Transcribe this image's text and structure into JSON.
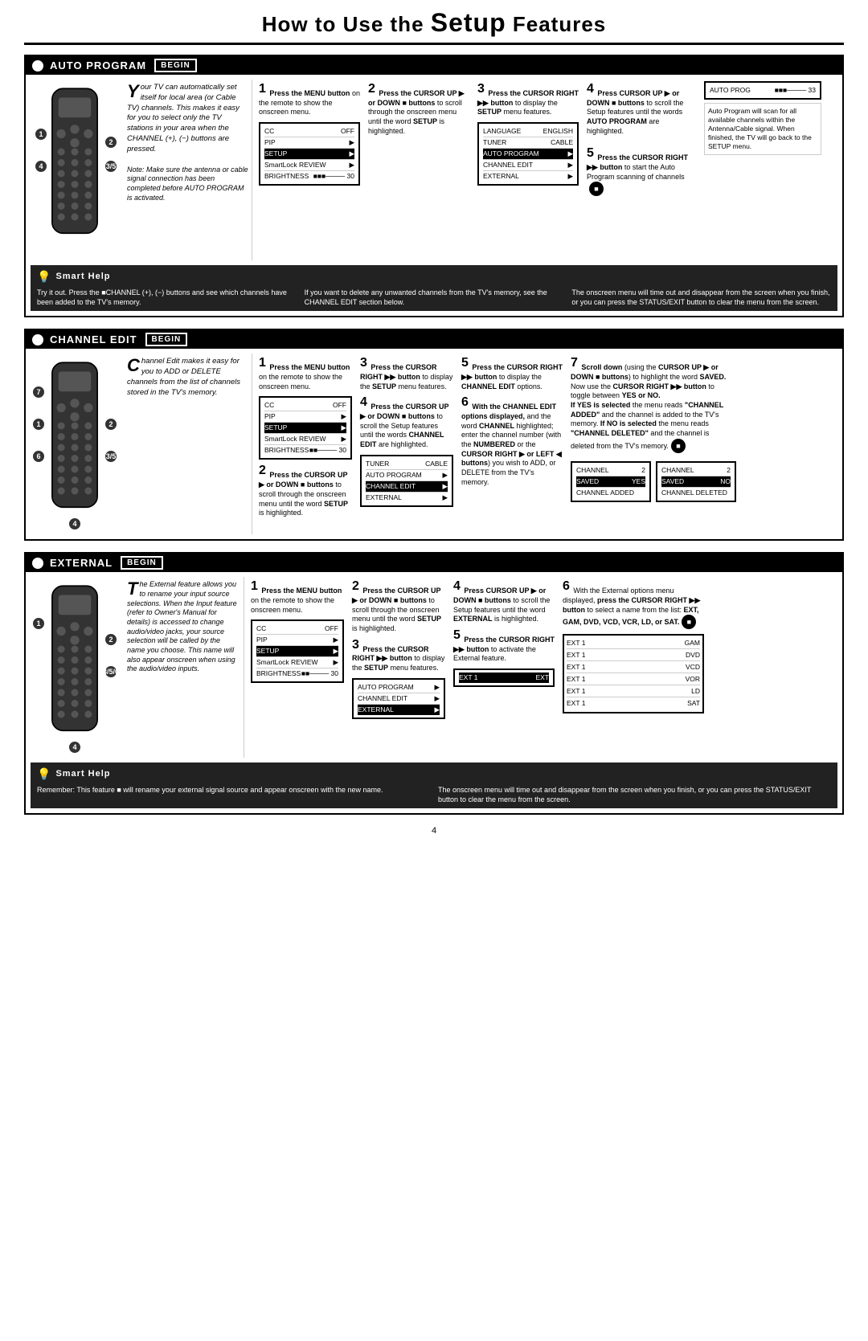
{
  "page": {
    "title_pre": "How to Use the ",
    "title_setup": "Setup",
    "title_post": " Features",
    "page_number": "4"
  },
  "auto_program": {
    "section_title": "Auto Program",
    "begin_label": "BEGIN",
    "intro": {
      "drop_cap": "Y",
      "text": "our TV can automatically set itself for local area (or Cable TV) channels. This makes it easy for you to select only the TV stations in your area when the CHANNEL (+), (−) buttons are pressed.\n\nNote: Make sure the antenna or cable signal connection has been completed before AUTO PROGRAM is activated."
    },
    "steps": [
      {
        "num": "1",
        "text": "Press the MENU button on the remote to show the onscreen menu."
      },
      {
        "num": "2",
        "text": "Press the CURSOR UP ▶ or DOWN ■ buttons to scroll through the onscreen menu until the word SETUP is highlighted."
      },
      {
        "num": "3",
        "text": "Press the CURSOR RIGHT ▶▶ button to display the SETUP menu features."
      },
      {
        "num": "4",
        "text": "Press CURSOR UP ▶ or DOWN ■ buttons to scroll the Setup features until the words AUTO PROGRAM are highlighted."
      },
      {
        "num": "5",
        "text": "Press the CURSOR RIGHT ▶▶ button to start the Auto Program scanning of channels"
      }
    ],
    "screen1": {
      "rows": [
        {
          "label": "CC",
          "value": "OFF",
          "highlighted": false
        },
        {
          "label": "PIP",
          "value": "▶",
          "highlighted": false
        },
        {
          "label": "SETUP",
          "value": "▶",
          "highlighted": true
        },
        {
          "label": "SmartLock REVIEW",
          "value": "▶",
          "highlighted": false
        },
        {
          "label": "BRIGHTNESS",
          "value": "■■■■---- 30",
          "highlighted": false
        }
      ]
    },
    "screen2": {
      "rows": [
        {
          "label": "LANGUAGE",
          "value": "ENGLISH",
          "highlighted": false
        },
        {
          "label": "TUNER",
          "value": "CABLE",
          "highlighted": false
        },
        {
          "label": "AUTO PROGRAM",
          "value": "▶",
          "highlighted": true
        },
        {
          "label": "CHANNEL EDIT",
          "value": "▶",
          "highlighted": false
        },
        {
          "label": "EXTERNAL",
          "value": "▶",
          "highlighted": false
        }
      ]
    },
    "screen3": {
      "rows": [
        {
          "label": "AUTO PROG",
          "value": "■■■■---- 33",
          "highlighted": false
        }
      ]
    },
    "auto_program_note": "Auto Program will scan for all available channels within the Antenna/Cable signal. When finished, the TV will go back to the SETUP menu.",
    "smart_help": {
      "title": "Smart Help",
      "col1": "Try it out. Press the ■CHANNEL (+), (−) buttons and see which channels have been added to the TV's memory.",
      "col2": "If you want to delete any unwanted channels from the TV's memory, see the CHANNEL EDIT section below.",
      "col3": "The onscreen menu will time out and disappear from the screen when you finish, or you can press the STATUS/EXIT button to clear the menu from the screen."
    }
  },
  "channel_edit": {
    "section_title": "Channel Edit",
    "begin_label": "BEGIN",
    "intro": {
      "drop_cap": "C",
      "text": "hannel Edit makes it easy for you to ADD or DELETE channels from the list of channels stored in the TV's memory."
    },
    "steps": [
      {
        "num": "1",
        "text": "Press the MENU button on the remote to show the onscreen menu."
      },
      {
        "num": "2",
        "text": "Press the CURSOR UP ▶ or DOWN ■ buttons to scroll through the onscreen menu until the word SETUP is highlighted."
      },
      {
        "num": "3",
        "text": "Press the CURSOR RIGHT ▶▶ button to display the SETUP menu features."
      },
      {
        "num": "4",
        "text": "Press the CURSOR UP ▶ or DOWN ■ buttons to scroll the Setup features until the words CHANNEL EDIT are highlighted."
      },
      {
        "num": "5",
        "text": "Press the CURSOR RIGHT ▶▶ button to display the CHANNEL EDIT options."
      },
      {
        "num": "6",
        "text": "With the CHANNEL EDIT options displayed, and the word CHANNEL highlighted; enter the channel number (with the NUMBERED or the CURSOR RIGHT ▶ or LEFT ◀ buttons) you wish to ADD, or DELETE from the TV's memory."
      },
      {
        "num": "7",
        "text": "Scroll down (using the CURSOR UP ▶ or DOWN ■ buttons) to highlight the word SAVED.\nNow use the CURSOR RIGHT ▶▶ button to toggle between YES or NO.\nIf YES is selected the menu reads \"CHANNEL ADDED\" and the channel is added to the TV's memory. If NO is selected the menu reads \"CHANNEL DELETED\" and the channel is deleted from the TV's memory."
      }
    ],
    "screen1": {
      "rows": [
        {
          "label": "CC",
          "value": "OFF",
          "highlighted": false
        },
        {
          "label": "PIP",
          "value": "▶",
          "highlighted": false
        },
        {
          "label": "SETUP",
          "value": "▶",
          "highlighted": true
        },
        {
          "label": "SmartLock REVIEW",
          "value": "▶",
          "highlighted": false
        },
        {
          "label": "BRIGHTNESS",
          "value": "■■■■---- 30",
          "highlighted": false
        }
      ]
    },
    "screen2": {
      "rows": [
        {
          "label": "TUNER",
          "value": "CABLE",
          "highlighted": false
        },
        {
          "label": "AUTO PROGRAM",
          "value": "▶",
          "highlighted": false
        },
        {
          "label": "CHANNEL EDIT",
          "value": "▶",
          "highlighted": true
        },
        {
          "label": "EXTERNAL",
          "value": "▶",
          "highlighted": false
        }
      ]
    },
    "screen3": {
      "rows": [
        {
          "label": "CHANNEL",
          "value": "2",
          "highlighted": false
        },
        {
          "label": "SAVED",
          "value": "YES",
          "highlighted": true
        },
        {
          "label": "CHANNEL ADDED",
          "value": "",
          "highlighted": false
        }
      ]
    },
    "screen4": {
      "rows": [
        {
          "label": "CHANNEL",
          "value": "2",
          "highlighted": false
        },
        {
          "label": "SAVED",
          "value": "NO",
          "highlighted": true
        },
        {
          "label": "CHANNEL DELETED",
          "value": "",
          "highlighted": false
        }
      ]
    }
  },
  "external": {
    "section_title": "External",
    "begin_label": "BEGIN",
    "intro": {
      "drop_cap": "T",
      "text": "he External feature allows you to rename your input source selections. When the Input feature (refer to Owner's Manual for details) is accessed to change audio/video jacks, your source selection will be called by the name you choose. This name will also appear onscreen when using the audio/video inputs."
    },
    "steps": [
      {
        "num": "1",
        "text": "Press the MENU button on the remote to show the onscreen menu."
      },
      {
        "num": "2",
        "text": "Press the CURSOR UP ▶ or DOWN ■ buttons to scroll through the onscreen menu until the word SETUP is highlighted."
      },
      {
        "num": "3",
        "text": "Press the CURSOR RIGHT ▶▶ button to display the SETUP menu features."
      },
      {
        "num": "4",
        "text": "Press CURSOR UP ▶ or DOWN ■ buttons to scroll the Setup features until the word EXTERNAL is highlighted."
      },
      {
        "num": "5",
        "text": "Press the CURSOR RIGHT ▶▶ button to activate the External feature."
      },
      {
        "num": "6",
        "text": "With the External options menu displayed, press the CURSOR RIGHT ▶▶ button to select a name from the list: EXT, GAM, DVD, VCD, VCR, LD, or SAT."
      }
    ],
    "screen1": {
      "rows": [
        {
          "label": "CC",
          "value": "OFF",
          "highlighted": false
        },
        {
          "label": "PIP",
          "value": "▶",
          "highlighted": false
        },
        {
          "label": "SETUP",
          "value": "▶",
          "highlighted": true
        },
        {
          "label": "SmartLock REVIEW",
          "value": "▶",
          "highlighted": false
        },
        {
          "label": "BRIGHTNESS",
          "value": "■■■■---- 30",
          "highlighted": false
        }
      ]
    },
    "screen2": {
      "rows": [
        {
          "label": "AUTO PROGRAM",
          "value": "▶",
          "highlighted": false
        },
        {
          "label": "CHANNEL EDIT",
          "value": "▶",
          "highlighted": false
        },
        {
          "label": "EXTERNAL",
          "value": "▶",
          "highlighted": true
        }
      ]
    },
    "screen3": {
      "rows": [
        {
          "label": "EXT 1",
          "value": "EXT",
          "highlighted": true
        }
      ]
    },
    "screen4_rows": [
      {
        "label": "EXT 1",
        "value": "GAM"
      },
      {
        "label": "EXT 1",
        "value": "DVD"
      },
      {
        "label": "EXT 1",
        "value": "VCD"
      },
      {
        "label": "EXT 1",
        "value": "VOR"
      },
      {
        "label": "EXT 1",
        "value": "LD"
      },
      {
        "label": "EXT 1",
        "value": "SAT"
      }
    ],
    "smart_help": {
      "title": "Smart Help",
      "col1": "Remember: This feature ■ will rename your external signal source and appear onscreen with the new name.",
      "col2": "The onscreen menu will time out and disappear from the screen when you finish, or you can press the STATUS/EXIT button to clear the menu from the screen."
    }
  }
}
